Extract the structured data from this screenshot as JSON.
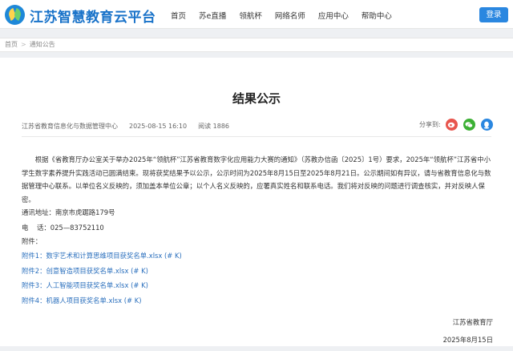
{
  "header": {
    "site_title": "江苏智慧教育云平台",
    "nav": [
      "首页",
      "苏e直播",
      "领航杯",
      "网络名师",
      "应用中心",
      "帮助中心"
    ],
    "login_label": "登录",
    "brand_color": "#1a73c9"
  },
  "breadcrumb": {
    "home": "首页",
    "sep": ">",
    "current": "通知公告"
  },
  "article": {
    "title": "结果公示",
    "publisher": "江苏省教育信息化与数据管理中心",
    "date": "2025-08-15 16:10",
    "views": "阅读 1886",
    "share_label": "分享到:",
    "share_icons": [
      "weibo-icon",
      "wechat-icon",
      "qq-icon"
    ],
    "paragraph": "根据《省教育厅办公室关于举办2025年“领航杯”江苏省教育数字化应用能力大赛的通知》（苏教办信函〔2025〕1号）要求，2025年“领航杯”江苏省中小学生数字素养提升实践活动已圆满结束。现将获奖结果予以公示，公示时间为2025年8月15日至2025年8月21日。公示期间如有异议，请与省教育信息化与数据管理中心联系。以单位名义反映的，须加盖本单位公章；以个人名义反映的，应署真实姓名和联系电话。我们将对反映的问题进行调查核实，并对反映人保密。",
    "address": "通讯地址：南京市虎踞路179号",
    "phone": "电    话：025—83752110",
    "attachments_label": "附件：",
    "attachments": [
      "附件1：数字艺术和计算思维项目获奖名单.xlsx (# K)",
      "附件2：创意智造项目获奖名单.xlsx (# K)",
      "附件3：人工智能项目获奖名单.xlsx (# K)",
      "附件4：机器人项目获奖名单.xlsx (# K)"
    ],
    "sign_org": "江苏省教育厅",
    "sign_date": "2025年8月15日"
  }
}
